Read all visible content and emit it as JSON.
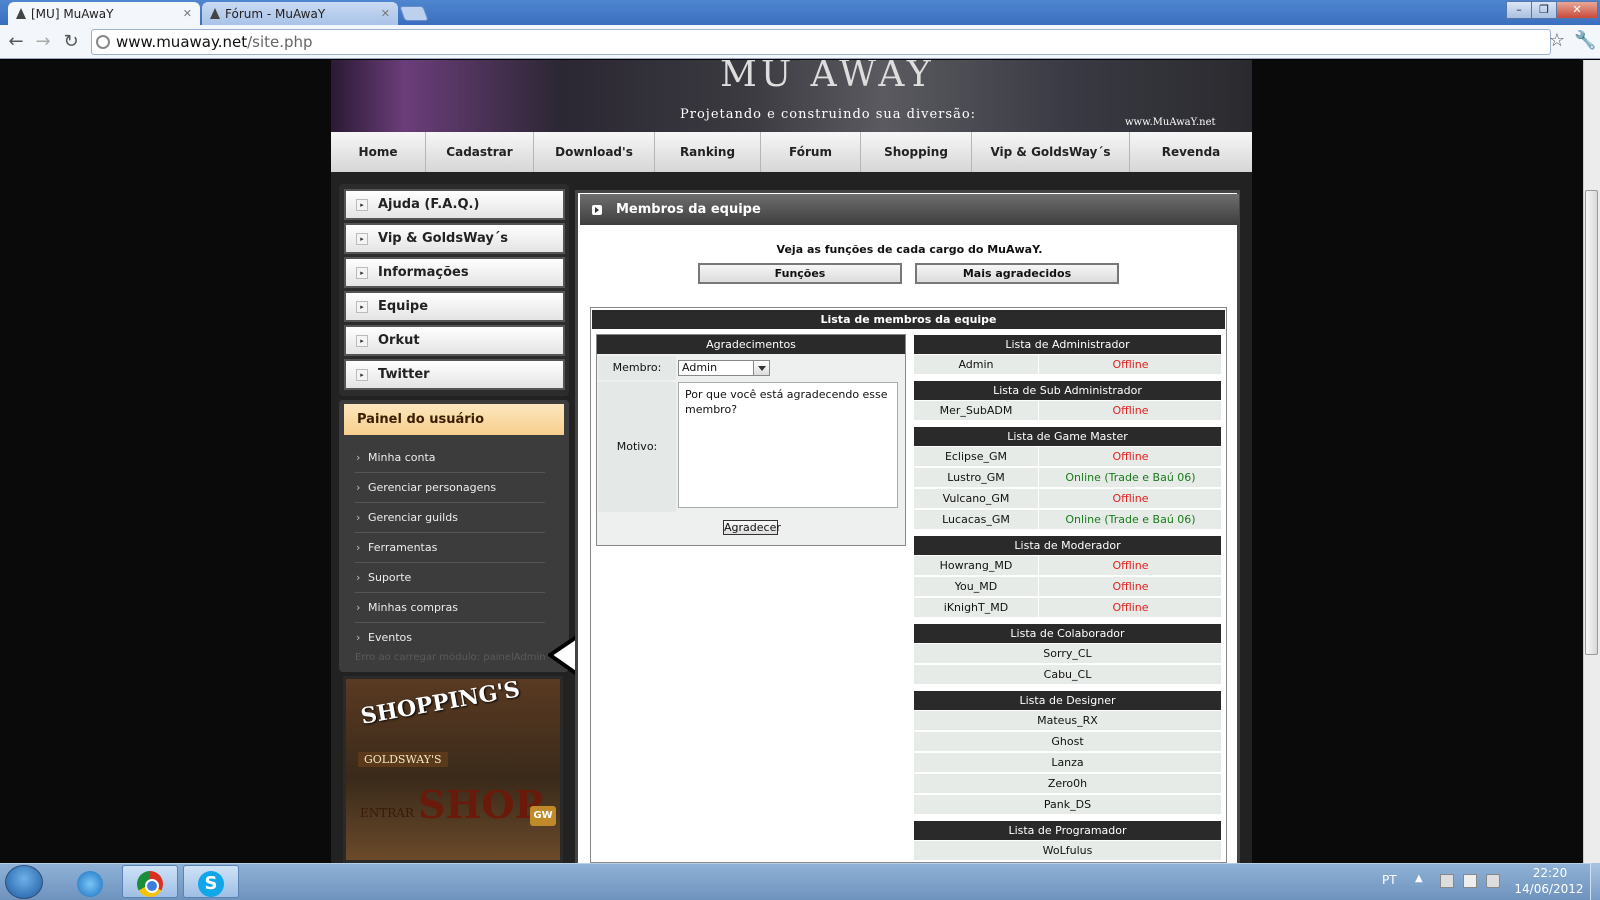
{
  "browser": {
    "tabs": [
      {
        "title": "[MU] MuAwaY",
        "active": true
      },
      {
        "title": "Fórum - MuAwaY",
        "active": false
      }
    ],
    "url_host": "www.muaway.net",
    "url_path": "/site.php",
    "window_controls": [
      "–",
      "❐",
      "✕"
    ]
  },
  "banner": {
    "logo": "MU AWAY",
    "slogan": "Projetando e construindo sua diversão:",
    "site": "www.MuAwaY.net"
  },
  "nav": [
    "Home",
    "Cadastrar",
    "Download's",
    "Ranking",
    "Fórum",
    "Shopping",
    "Vip & GoldsWay´s",
    "Revenda"
  ],
  "sidebar": {
    "menu": [
      "Ajuda (F.A.Q.)",
      "Vip & GoldsWay´s",
      "Informações",
      "Equipe",
      "Orkut",
      "Twitter"
    ],
    "panel_title": "Painel do usuário",
    "panel_links": [
      "Minha conta",
      "Gerenciar personagens",
      "Gerenciar guilds",
      "Ferramentas",
      "Suporte",
      "Minhas compras",
      "Eventos"
    ],
    "panel_error": "Erro ao carregar módulo: painelAdmin",
    "shop_banner": {
      "line1": "SHOPPING'S",
      "line2": "GOLDSWAY'S",
      "line3": "ENTRAR",
      "line4": "SHOP",
      "badge": "GW"
    }
  },
  "main": {
    "title": "Membros da equipe",
    "intro": "Veja as funções de cada cargo do MuAwaY.",
    "buttons": [
      "Funções",
      "Mais agradecidos"
    ],
    "list_title": "Lista de membros da equipe",
    "agradecimentos": {
      "title": "Agradecimentos",
      "member_label": "Membro:",
      "member_value": "Admin",
      "reason_label": "Motivo:",
      "reason_text": "Por que você está agradecendo esse membro?",
      "submit": "Agradecer"
    },
    "sections": [
      {
        "title": "Lista de Administrador",
        "members": [
          {
            "name": "Admin",
            "status": "Offline",
            "online": false
          }
        ]
      },
      {
        "title": "Lista de Sub Administrador",
        "members": [
          {
            "name": "Mer_SubADM",
            "status": "Offline",
            "online": false
          }
        ]
      },
      {
        "title": "Lista de Game Master",
        "members": [
          {
            "name": "Eclipse_GM",
            "status": "Offline",
            "online": false
          },
          {
            "name": "Lustro_GM",
            "status": "Online (Trade e Baú 06)",
            "online": true
          },
          {
            "name": "Vulcano_GM",
            "status": "Offline",
            "online": false
          },
          {
            "name": "Lucacas_GM",
            "status": "Online (Trade e Baú 06)",
            "online": true
          }
        ]
      },
      {
        "title": "Lista de Moderador",
        "members": [
          {
            "name": "Howrang_MD",
            "status": "Offline",
            "online": false
          },
          {
            "name": "You_MD",
            "status": "Offline",
            "online": false
          },
          {
            "name": "iKnighT_MD",
            "status": "Offline",
            "online": false
          }
        ]
      },
      {
        "title": "Lista de Colaborador",
        "members": [
          {
            "name": "Sorry_CL"
          },
          {
            "name": "Cabu_CL"
          }
        ]
      },
      {
        "title": "Lista de Designer",
        "members": [
          {
            "name": "Mateus_RX"
          },
          {
            "name": "Ghost"
          },
          {
            "name": "Lanza"
          },
          {
            "name": "Zero0h"
          },
          {
            "name": "Pank_DS"
          }
        ]
      },
      {
        "title": "Lista de Programador",
        "members": [
          {
            "name": "WoLfulus"
          }
        ]
      }
    ]
  },
  "taskbar": {
    "lang": "PT",
    "time": "22:20",
    "date": "14/06/2012"
  },
  "colors": {
    "offline": "#e02020",
    "online": "#1a7a1a",
    "panel_accent": "#f6cf8d"
  }
}
